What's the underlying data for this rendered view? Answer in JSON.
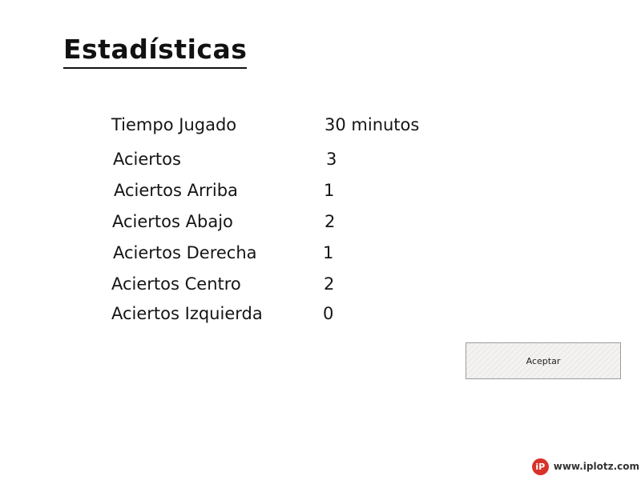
{
  "page": {
    "title": "Estadísticas"
  },
  "stats": [
    {
      "label": "Tiempo Jugado",
      "value": "30 minutos"
    },
    {
      "label": "Aciertos",
      "value": "3"
    },
    {
      "label": "Aciertos Arriba",
      "value": "1"
    },
    {
      "label": "Aciertos Abajo",
      "value": "2"
    },
    {
      "label": "Aciertos Derecha",
      "value": "1"
    },
    {
      "label": "Aciertos Centro",
      "value": "2"
    },
    {
      "label": "Aciertos Izquierda",
      "value": "0"
    }
  ],
  "actions": {
    "accept_label": "Aceptar"
  },
  "watermark": {
    "logo_text": "iP",
    "site": "www.iplotz.com"
  }
}
